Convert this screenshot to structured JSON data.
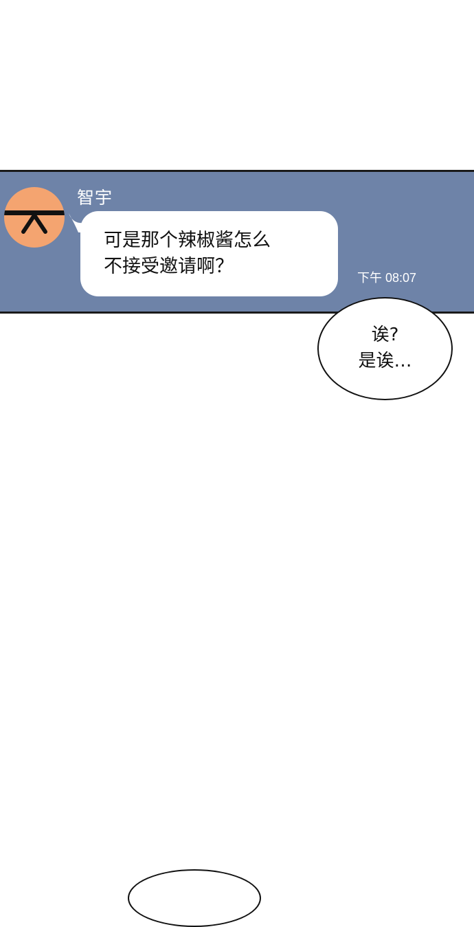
{
  "chat": {
    "sender_name": "智宇",
    "message": "可是那个辣椒酱怎么\n不接受邀请啊？",
    "timestamp": "下午 08:07",
    "panel_color": "#6e83a8",
    "avatar_color": "#f4a470",
    "avatar_icon": "ninja-face-icon"
  },
  "speech": {
    "text": "诶?\n是诶…"
  }
}
